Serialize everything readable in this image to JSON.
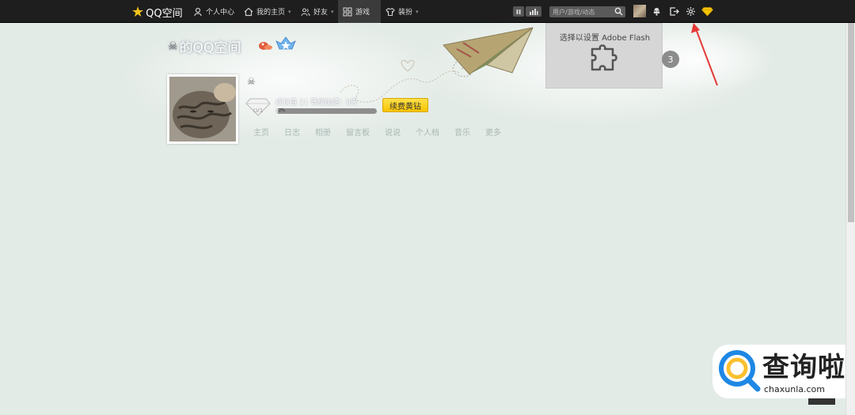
{
  "topbar": {
    "logo": "QQ空间",
    "nav": [
      {
        "label": "个人中心",
        "icon": "person-icon"
      },
      {
        "label": "我的主页",
        "icon": "home-icon"
      },
      {
        "label": "好友",
        "icon": "friends-icon"
      },
      {
        "label": "游戏",
        "icon": "grid-icon"
      },
      {
        "label": "装扮",
        "icon": "shirt-icon"
      }
    ],
    "search_placeholder": "用户/游戏/动态"
  },
  "header": {
    "site_title": "的QQ空间"
  },
  "flash_popup": {
    "text": "选择以设置 Adobe Flash"
  },
  "notification_count": "3",
  "profile": {
    "level": "LV1",
    "level_text": "成长值 11  等级加速：0天",
    "progress_label": "2%",
    "progress_fraction": 0.02,
    "renew_label": "续费黄钻",
    "nav": [
      "主页",
      "日志",
      "相册",
      "留言板",
      "说说",
      "个人档",
      "音乐",
      "更多"
    ]
  },
  "watermark": {
    "brand": "查询啦",
    "url": "chaxunla.com"
  },
  "colors": {
    "topbar": "#1e1e1e",
    "background": "#e3ebe6",
    "renew_button": "#f7c400",
    "annotation_arrow": "#e53935"
  }
}
